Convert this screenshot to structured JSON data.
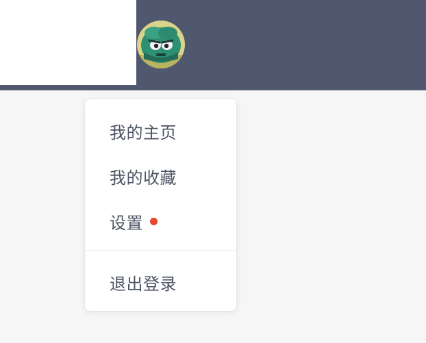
{
  "header": {
    "avatar_icon": "user-avatar-icon"
  },
  "menu": {
    "items": [
      {
        "label": "我的主页"
      },
      {
        "label": "我的收藏"
      },
      {
        "label": "设置",
        "notification_dot_color": "#e8462d"
      }
    ],
    "logout_label": "退出登录"
  },
  "colors": {
    "header_bg": "#50586f",
    "page_bg": "#f6f6f7",
    "menu_text": "#4d5563",
    "notification_dot": "#e8462d"
  }
}
